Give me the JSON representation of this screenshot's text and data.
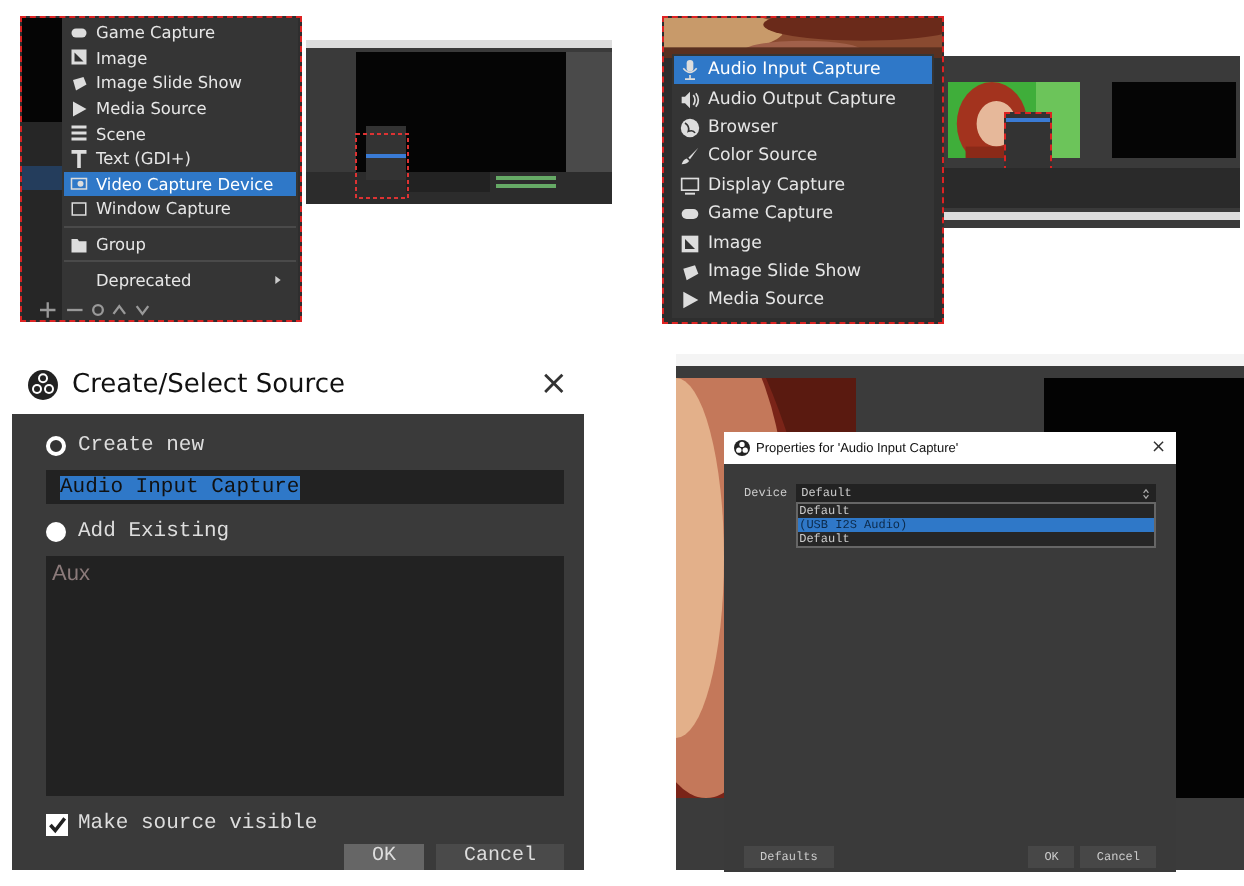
{
  "menu_a": {
    "items": [
      {
        "kind": "item",
        "label": "Game Capture",
        "selected": false
      },
      {
        "kind": "item",
        "label": "Image",
        "selected": false
      },
      {
        "kind": "item",
        "label": "Image Slide Show",
        "selected": false
      },
      {
        "kind": "item",
        "label": "Media Source",
        "selected": false
      },
      {
        "kind": "item",
        "label": "Scene",
        "selected": false
      },
      {
        "kind": "item",
        "label": "Text (GDI+)",
        "selected": false
      },
      {
        "kind": "item",
        "label": "Video Capture Device",
        "selected": true
      },
      {
        "kind": "item",
        "label": "Window Capture",
        "selected": false
      },
      {
        "kind": "separator"
      },
      {
        "kind": "item",
        "label": "Group",
        "selected": false
      },
      {
        "kind": "separator"
      },
      {
        "kind": "submenu",
        "label": "Deprecated",
        "selected": false
      }
    ]
  },
  "menu_b": {
    "items": [
      {
        "label": "Audio Input Capture",
        "selected": true
      },
      {
        "label": "Audio Output Capture",
        "selected": false
      },
      {
        "label": "Browser",
        "selected": false
      },
      {
        "label": "Color Source",
        "selected": false
      },
      {
        "label": "Display Capture",
        "selected": false
      },
      {
        "label": "Game Capture",
        "selected": false
      },
      {
        "label": "Image",
        "selected": false
      },
      {
        "label": "Image Slide Show",
        "selected": false
      },
      {
        "label": "Media Source",
        "selected": false
      }
    ]
  },
  "create_dialog": {
    "title": "Create/Select Source",
    "close": "×",
    "options": [
      {
        "label": "Create new",
        "selected": true
      },
      {
        "label": "Add Existing",
        "selected": false
      }
    ],
    "name_value": "Audio Input Capture",
    "existing": [
      "Aux"
    ],
    "visible": {
      "label": "Make source visible",
      "checked": true
    },
    "buttons": [
      "OK",
      "Cancel"
    ]
  },
  "properties_dialog": {
    "title": "Properties for 'Audio Input Capture'",
    "close": "×",
    "device_label": "Device",
    "device_value": "Default",
    "options": [
      {
        "label": "Default",
        "selected": false
      },
      {
        "label": "(USB I2S Audio)",
        "selected": true
      },
      {
        "label": "Default",
        "selected": false
      }
    ],
    "buttons": [
      "Defaults",
      "OK",
      "Cancel"
    ]
  }
}
